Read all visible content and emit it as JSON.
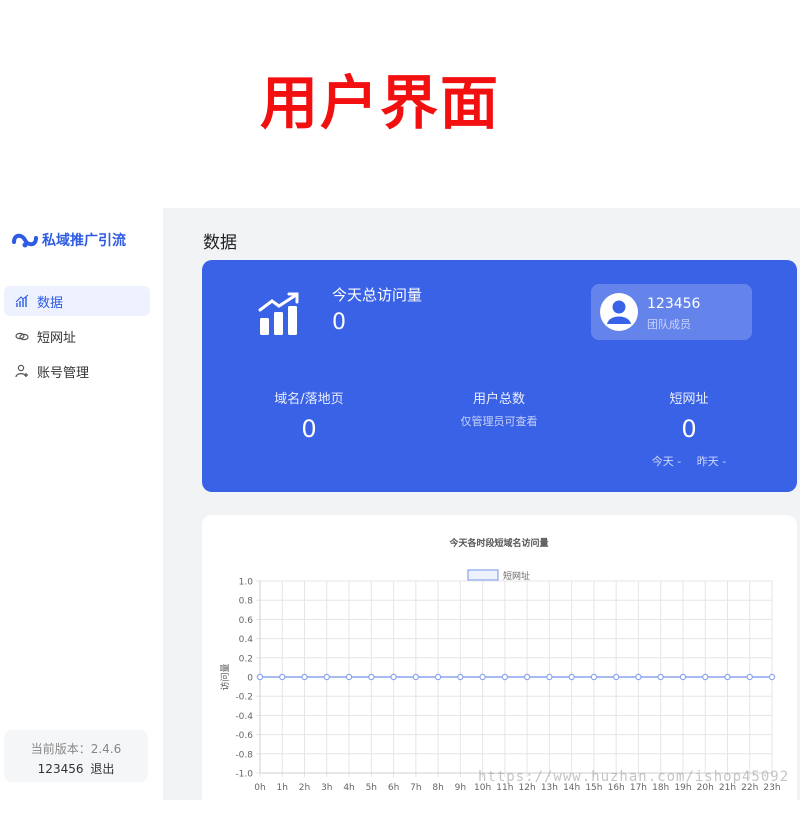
{
  "page_heading": "用户界面",
  "sidebar": {
    "logo_text": "私域推广引流",
    "items": [
      {
        "label": "数据",
        "icon": "bar-chart-icon",
        "active": true
      },
      {
        "label": "短网址",
        "icon": "link-icon",
        "active": false
      },
      {
        "label": "账号管理",
        "icon": "user-add-icon",
        "active": false
      }
    ],
    "version_label": "当前版本：2.4.6",
    "user_id": "123456",
    "logout_label": "退出"
  },
  "main": {
    "title": "数据",
    "hero": {
      "visits_label": "今天总访问量",
      "visits_value": "0",
      "user": {
        "name": "123456",
        "role": "团队成员"
      },
      "stats": [
        {
          "label": "域名/落地页",
          "value": "0"
        },
        {
          "label": "用户总数",
          "note": "仅管理员可查看"
        },
        {
          "label": "短网址",
          "value": "0",
          "sub": [
            "今天 -",
            "昨天 -"
          ]
        }
      ],
      "accent_color": "#3a62e6"
    }
  },
  "chart_data": {
    "type": "line",
    "title": "今天各时段短域名访问量",
    "ylabel": "访问量",
    "xlabel": "",
    "categories": [
      "0h",
      "1h",
      "2h",
      "3h",
      "4h",
      "5h",
      "6h",
      "7h",
      "8h",
      "9h",
      "10h",
      "11h",
      "12h",
      "13h",
      "14h",
      "15h",
      "16h",
      "17h",
      "18h",
      "19h",
      "20h",
      "21h",
      "22h",
      "23h"
    ],
    "series": [
      {
        "name": "短网址",
        "values": [
          0,
          0,
          0,
          0,
          0,
          0,
          0,
          0,
          0,
          0,
          0,
          0,
          0,
          0,
          0,
          0,
          0,
          0,
          0,
          0,
          0,
          0,
          0,
          0
        ],
        "color": "#8aa4ee"
      }
    ],
    "ylim": [
      -1.0,
      1.0
    ],
    "yticks": [
      "1.0",
      "0.8",
      "0.6",
      "0.4",
      "0.2",
      "0",
      "-0.2",
      "-0.4",
      "-0.6",
      "-0.8",
      "-1.0"
    ],
    "grid": true,
    "legend": "top-center"
  },
  "watermark": "https://www.huzhan.com/ishop45092"
}
